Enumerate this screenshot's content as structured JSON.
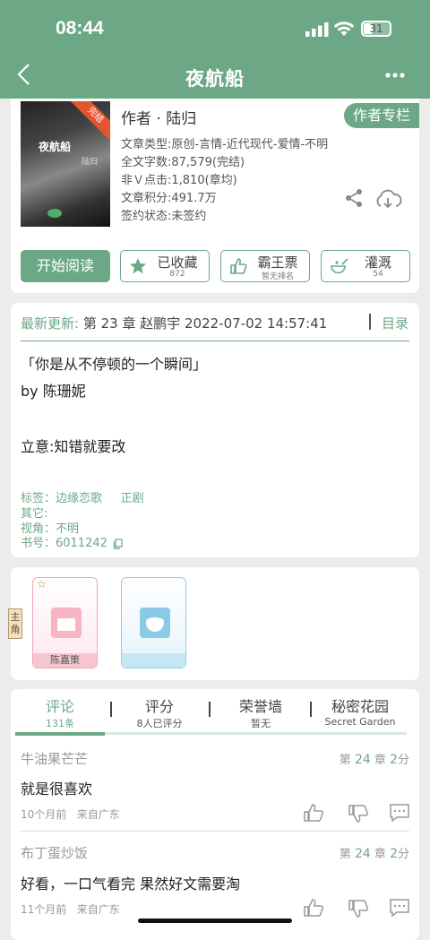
{
  "status_bar": {
    "time": "08:44",
    "battery": "31"
  },
  "header": {
    "title": "夜航船"
  },
  "book": {
    "cover_title": "夜航船",
    "cover_author": "陆归",
    "cover_ribbon": "完结",
    "author_line": "作者 · 陆归",
    "author_column": "作者专栏",
    "info": [
      "文章类型:原创-言情-近代现代-爱情-不明",
      "全文字数:87,579(完结)",
      "非Ｖ点击:1,810(章均)",
      "文章积分:491.7万",
      "签约状态:未签约"
    ]
  },
  "actions": {
    "start_read": "开始阅读",
    "collect": {
      "label": "已收藏",
      "sub": "872"
    },
    "vote": {
      "label": "霸王票",
      "sub": "暂无排名"
    },
    "water": {
      "label": "灌溉",
      "sub": "54"
    }
  },
  "update": {
    "prefix": "最新更新:",
    "text": "第 23 章 赵鹏宇 2022-07-02 14:57:41",
    "catalog": "目录"
  },
  "description": [
    "「你是从不停顿的一个瞬间」",
    "by 陈珊妮",
    "立意:知错就要改"
  ],
  "tags": {
    "tags": "标签：边缘恋歌     正剧",
    "other": "其它:",
    "view": "视角：不明",
    "book_no": "书号：6011242"
  },
  "characters": {
    "badge": "主角",
    "list": [
      {
        "name": "陈嘉策"
      },
      {
        "name": ""
      }
    ]
  },
  "tabs": [
    {
      "label": "评论",
      "sub": "131条"
    },
    {
      "label": "评分",
      "sub": "8人已评分"
    },
    {
      "label": "荣誉墙",
      "sub": "暂无"
    },
    {
      "label": "秘密花园",
      "sub": "Secret Garden"
    }
  ],
  "comments": [
    {
      "user": "牛油果芒芒",
      "chapter_pre": "第",
      "chapter": "24",
      "chapter_mid": "章",
      "score": "2",
      "score_suf": "分",
      "text": "就是很喜欢",
      "meta": "10个月前   来自广东"
    },
    {
      "user": "布丁蛋炒饭",
      "chapter_pre": "第",
      "chapter": "24",
      "chapter_mid": "章",
      "score": "2",
      "score_suf": "分",
      "text": "好看，一口气看完 果然好文需要淘",
      "meta": "11个月前   来自广东"
    }
  ],
  "colors": {
    "accent": "#6ca886",
    "ribbon": "#e2552e"
  }
}
